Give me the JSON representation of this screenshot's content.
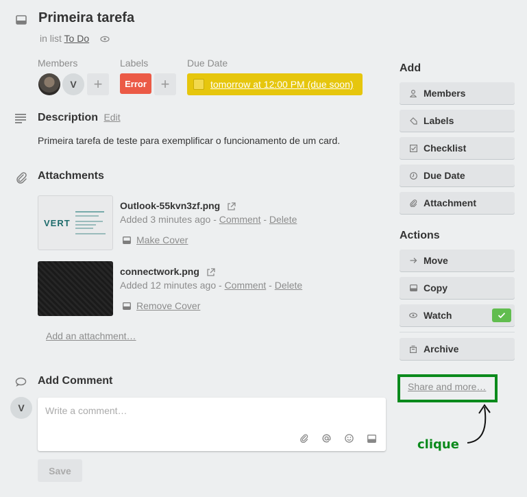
{
  "card": {
    "title": "Primeira tarefa",
    "in_list_prefix": "in list",
    "list_name": "To Do"
  },
  "meta": {
    "members_label": "Members",
    "labels_label": "Labels",
    "due_label": "Due Date",
    "member_initial": "V",
    "plus": "+",
    "label_error": "Error",
    "due_text": "tomorrow at 12:00 PM (due soon)"
  },
  "description": {
    "heading": "Description",
    "edit": "Edit",
    "text": "Primeira tarefa de teste para exemplificar o funcionamento de um card."
  },
  "attachments": {
    "heading": "Attachments",
    "items": [
      {
        "name": "Outlook-55kvn3zf.png",
        "added": "Added 3 minutes ago",
        "comment": "Comment",
        "delete": "Delete",
        "cover": "Make Cover",
        "thumb_text": "VERT"
      },
      {
        "name": "connectwork.png",
        "added": "Added 12 minutes ago",
        "comment": "Comment",
        "delete": "Delete",
        "cover": "Remove Cover"
      }
    ],
    "add": "Add an attachment…",
    "sep": "-"
  },
  "comment": {
    "heading": "Add Comment",
    "avatar_initial": "V",
    "placeholder": "Write a comment…",
    "save": "Save"
  },
  "sidebar": {
    "add_heading": "Add",
    "add_buttons": [
      "Members",
      "Labels",
      "Checklist",
      "Due Date",
      "Attachment"
    ],
    "actions_heading": "Actions",
    "action_buttons": [
      "Move",
      "Copy",
      "Watch",
      "Archive"
    ],
    "share": "Share and more…"
  },
  "annotation": {
    "text": "clique",
    "color": "#0b8a1c"
  },
  "colors": {
    "label_error": "#eb5a46",
    "due_soon": "#e6c60d",
    "watch_check": "#61bd4f"
  }
}
